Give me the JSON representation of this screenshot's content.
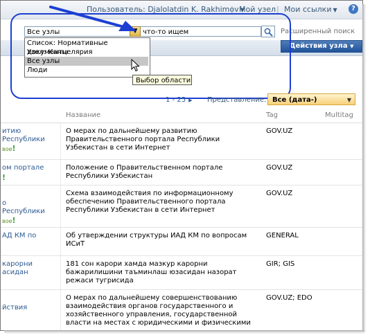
{
  "topbar": {
    "user_label": "Пользователь: Djalolatdin K. Rakhimov",
    "my_site": "Мой узел",
    "my_links": "Мои ссылки",
    "help": "?"
  },
  "search": {
    "scope_value": "Все узлы",
    "query_value": "что-то ищем",
    "advanced": "Расширенный поиск",
    "scope_options": [
      "Список: Нормативные документы",
      "Узел: Канцелярия",
      "Все узлы",
      "Люди"
    ],
    "tooltip": "Выбор области"
  },
  "ribbon": {
    "actions": "Действия узла"
  },
  "pager": {
    "range": "1 - 25",
    "next": "▶"
  },
  "view": {
    "label": "Представление:",
    "value": "Все (дата-)"
  },
  "table": {
    "headers": [
      "Название",
      "Tag",
      "Multitag"
    ],
    "rows": [
      {
        "c1": "итию\nРеспублики",
        "new": "вое",
        "name": "О мерах по дальнейшему развитию Правительственного портала Республики Узбекистан в сети Интернет",
        "tag": "GOV.UZ"
      },
      {
        "c1": "ом портале",
        "new": "",
        "name": "Положение о Правительственном портале Республики Узбекистан",
        "tag": "GOV.UZ"
      },
      {
        "c1": "о\nРеспублики",
        "new": "вое",
        "name": "Схема взаимодействия по информационному обеспечению Правительственного портала Республики Узбекистан в сети Интернет",
        "tag": "GOV.UZ"
      },
      {
        "c1": "АД КМ по",
        "new": "",
        "name": "Об утверждении структуры ИАД КМ по вопросам ИСиТ",
        "tag": "GENERAL"
      },
      {
        "c1": "карорни\nасидан",
        "new": "",
        "name": "181 сон карори хамда мазкур карорни бажарилишини таъминлаш юзасидан назорат режаси тугрисида",
        "tag": "GIR; GIS"
      },
      {
        "c1": "йствия",
        "new": "",
        "name": "О мерах по дальнейшему совершенствованию взаимодействия органов государственного и хозяйственного управления, государственной власти на местах с юридическими и физическими",
        "tag": "GOV.UZ; EDO"
      }
    ]
  }
}
